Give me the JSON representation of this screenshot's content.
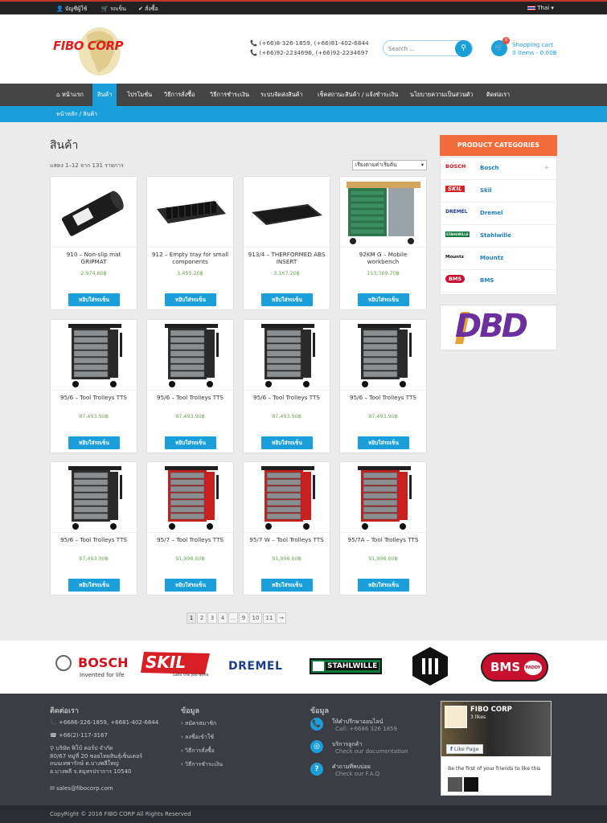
{
  "topbar": {
    "account": "บัญชีผู้ใช้",
    "wishlist": "รถเข็น",
    "checkout": "สั่งซื้อ",
    "language": "Thai"
  },
  "header": {
    "logo_text": "FIBO CORP",
    "phone1": "(+66)8-326-1859, (+66)81-402-6844",
    "phone2": "(+66)92-2234696, (+66)92-2234697",
    "search_placeholder": "Search ...",
    "cart_count": "0",
    "cart_title": "Shopping cart",
    "cart_summary": "0 items - 0.00฿"
  },
  "nav": [
    "หน้าแรก",
    "สินค้า",
    "โปรโมชั่น",
    "วิธีการสั่งซื้อ",
    "วิธีการชำระเงิน",
    "ระบบจัดส่งสินค้า",
    "เช็คสถานะสินค้า / แจ้งชำระเงิน",
    "นโยบายความเป็นส่วนตัว",
    "ติดต่อเรา"
  ],
  "breadcrumb": "หน้าหลัก / สินค้า",
  "main": {
    "title": "สินค้า",
    "result_count": "แสดง 1–12 จาก 131 รายการ",
    "sort_selected": "เรียงตามค่าเริ่มต้น"
  },
  "add_to_cart_label": "หยิบใส่รถเข็น",
  "products": [
    {
      "name": "910 – Non-slip mat GRIPMAT",
      "price": "2,974.60฿",
      "img": "mat"
    },
    {
      "name": "912 – Empty tray for small components",
      "price": "1,455.20฿",
      "img": "tray"
    },
    {
      "name": "913/4 – THERFORMED ABS INSERT",
      "price": "3,167.20฿",
      "img": "insert"
    },
    {
      "name": "92KM G – Mobile workbench",
      "price": "153,769.70฿",
      "img": "workbench"
    },
    {
      "name": "95/6 – Tool Trolleys TTS",
      "price": "87,493.90฿",
      "img": "trolley-gray"
    },
    {
      "name": "95/6 – Tool Trolleys TTS",
      "price": "87,493.90฿",
      "img": "trolley-gray"
    },
    {
      "name": "95/6 – Tool Trolleys TTS",
      "price": "87,493.90฿",
      "img": "trolley-gray"
    },
    {
      "name": "95/6 – Tool Trolleys TTS",
      "price": "87,493.90฿",
      "img": "trolley-gray"
    },
    {
      "name": "95/6 – Tool Trolleys TTS",
      "price": "87,493.90฿",
      "img": "trolley-gray"
    },
    {
      "name": "95/7 – Tool Trolleys TTS",
      "price": "91,998.60฿",
      "img": "trolley-red"
    },
    {
      "name": "95/7 W – Tool Trolleys TTS",
      "price": "91,998.60฿",
      "img": "trolley-red"
    },
    {
      "name": "95/7A – Tool Trolleys TTS",
      "price": "91,998.60฿",
      "img": "trolley-red"
    }
  ],
  "pagination": [
    "1",
    "2",
    "3",
    "4",
    "…",
    "9",
    "10",
    "11",
    "→"
  ],
  "sidebar": {
    "categories_title": "PRODUCT CATEGORIES",
    "categories": [
      {
        "label": "Bosch",
        "logo_text": "BOSCH",
        "has_children": true,
        "toggle": "+"
      },
      {
        "label": "Skil",
        "logo_text": "SKIL",
        "has_children": false
      },
      {
        "label": "Dremel",
        "logo_text": "DREMEL",
        "has_children": false
      },
      {
        "label": "Stahlwille",
        "logo_text": "STAHLWILLE",
        "has_children": false
      },
      {
        "label": "Mountz",
        "logo_text": "Mountz",
        "has_children": false
      },
      {
        "label": "BMS",
        "logo_text": "BMS",
        "has_children": false
      }
    ],
    "dbd_text": "DBD"
  },
  "brands": {
    "bosch": "BOSCH",
    "bosch_tag": "Invented for life",
    "skil": "SKIL",
    "skil_tag": "Gets the job done",
    "dremel": "DREMEL",
    "stahlwille": "STAHLWILLE",
    "bms": "BMS",
    "bms_sub": "PADDY"
  },
  "footer": {
    "contact_title": "ติดต่อเรา",
    "contact_phone": "+6686-326-1859, +6681-402-6844",
    "contact_fax": "+66(2)-117-3167",
    "address_1": "บริษัท ฟิโบ้ คอร์ป จำกัด",
    "address_2": "80/67 หมู่ที่ 20 ซอยไทยสินธุ์เซ็นเตอร์",
    "address_3": "ถนนเทพารักษ์ ต.บางพลีใหญ่",
    "address_4": "อ.บางพลี จ.สมุทรปราการ 10540",
    "email": "sales@fibocorp.com",
    "info_title": "ข้อมูล",
    "info_links": [
      "สมัครสมาชิก",
      "ลงชื่อเข้าใช้",
      "วิธีการสั่งซื้อ",
      "วิธีการชำระเงิน"
    ],
    "help_title": "ข้อมูล",
    "help": [
      {
        "title": "ให้คำปรึกษาออนไลน์",
        "sub": "Call: +6686 326 1859"
      },
      {
        "title": "บริการลูกค้า",
        "sub": "Check our documentation"
      },
      {
        "title": "คำถามที่พบบ่อย",
        "sub": "Check our F.A.Q"
      }
    ],
    "fb_page_name": "FIBO CORP",
    "fb_likes": "3 likes",
    "fb_like_button": "Like Page",
    "fb_friends": "Be the first of your friends to like this",
    "copyright": "CopyRight © 2016 FIBO CORP All Rights Reserved"
  }
}
